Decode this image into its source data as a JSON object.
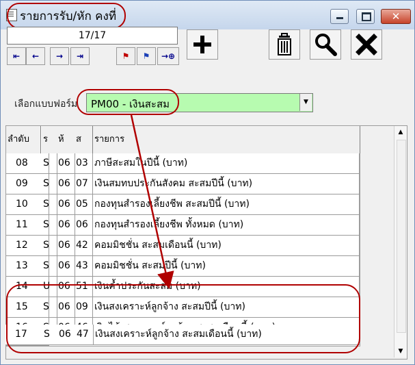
{
  "window": {
    "title": "รายการรับ/หัก คงที่",
    "close_glyph": "✕"
  },
  "record_counter": "17/17",
  "nav": {
    "first": "⇤",
    "prev": "←",
    "next": "→",
    "last": "⇥",
    "flag1": "⚑",
    "flag2": "⚑",
    "goto": "→⊕"
  },
  "form_selector": {
    "label": "เลือกแบบฟอร์ม",
    "value": "PM00 - เงินสะสม",
    "arrow": "▼"
  },
  "table": {
    "columns": [
      "ลำดับ",
      "ร",
      "ห้",
      "ส",
      "รายการ"
    ],
    "rows": [
      [
        "08",
        "S",
        "06",
        "03",
        "ภาษีสะสมในปีนี้ (บาท)"
      ],
      [
        "09",
        "S",
        "06",
        "07",
        "เงินสมทบประกันสังคม สะสมปีนี้ (บาท)"
      ],
      [
        "10",
        "S",
        "06",
        "05",
        "กองทุนสำรองเลี้ยงชีพ สะสมปีนี้ (บาท)"
      ],
      [
        "11",
        "S",
        "06",
        "06",
        "กองทุนสำรองเลี้ยงชีพ ทั้งหมด (บาท)"
      ],
      [
        "12",
        "S",
        "06",
        "42",
        "คอมมิชชั่น สะสมเดือนนี้ (บาท)"
      ],
      [
        "13",
        "S",
        "06",
        "43",
        "คอมมิชชั่น สะสมปีนี้ (บาท)"
      ],
      [
        "14",
        "U",
        "06",
        "51",
        "เงินค้ำประกันสะสม (บาท)"
      ],
      [
        "15",
        "S",
        "06",
        "09",
        "เงินสงเคราะห์ลูกจ้าง สะสมปีนี้ (บาท)"
      ],
      [
        "16",
        "S",
        "06",
        "46",
        "เงินได้-สงเคราะห์ลูกจ้าง สะสมเดือนนี้ (บาท)"
      ],
      [
        "17",
        "S",
        "06",
        "47",
        "เงินสงเคราะห์ลูกจ้าง สะสมเดือนนี้ (บาท)"
      ]
    ]
  },
  "scrollbar": {
    "up": "▲",
    "down": "▼"
  },
  "annotation_color": "#b00000"
}
